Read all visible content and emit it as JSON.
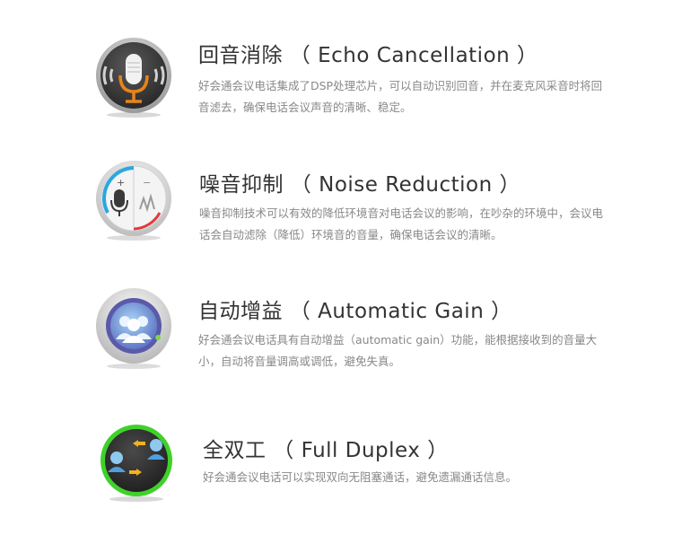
{
  "features": [
    {
      "icon": "microphone-echo-icon",
      "title": "回音消除 （ Echo Cancellation ）",
      "description": "好会通会议电话集成了DSP处理芯片，可以自动识别回音，并在麦克风采音时将回音滤去，确保电话会议声音的清晰、稳定。"
    },
    {
      "icon": "microphone-volume-dial-icon",
      "title": "噪音抑制 （ Noise Reduction ）",
      "description": "噪音抑制技术可以有效的降低环境音对电话会议的影响，在吵杂的环境中，会议电话会自动滤除（降低）环境音的音量，确保电话会议的清晰。"
    },
    {
      "icon": "user-group-dial-icon",
      "title": "自动增益 （ Automatic Gain ）",
      "description": "好会通会议电话具有自动增益（automatic gain）功能，能根据接收到的音量大小，自动将音量调高或调低，避免失真。"
    },
    {
      "icon": "two-way-users-icon",
      "title": "全双工 （ Full Duplex ）",
      "description": "好会通会议电话可以实现双向无阻塞通话，避免遗漏通话信息。"
    }
  ],
  "colors": {
    "title": "#333333",
    "description": "#888888",
    "accent_orange": "#e8841c",
    "accent_blue": "#2aa7e0",
    "accent_green": "#3fd12a"
  }
}
